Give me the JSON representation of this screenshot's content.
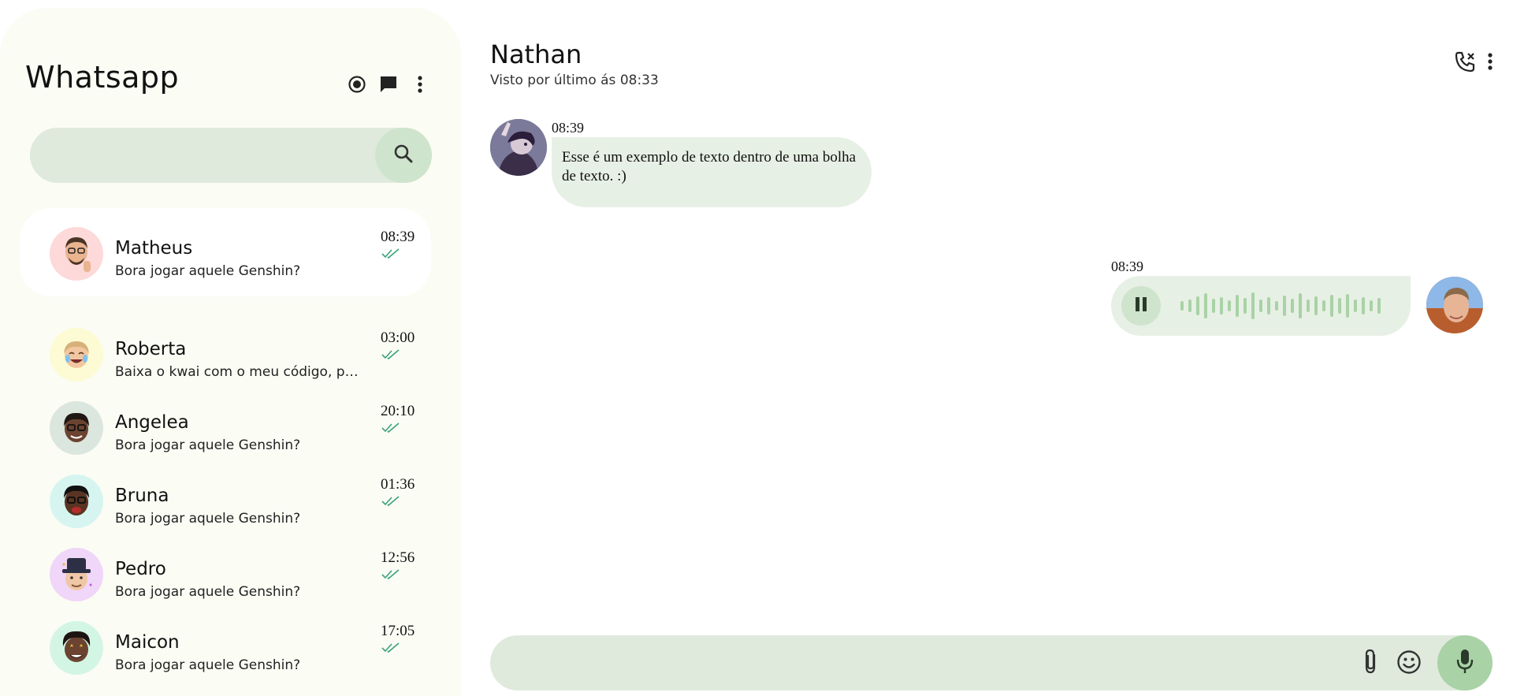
{
  "sidebar": {
    "title": "Whatsapp",
    "icons": [
      "status-icon",
      "new-chat-icon",
      "more-vert-icon"
    ],
    "search": {
      "placeholder": "",
      "icon": "search-icon"
    },
    "chats": [
      {
        "name": "Matheus",
        "preview": "Bora jogar aquele Genshin?",
        "time": "08:39",
        "read": true,
        "active": true,
        "avatar_bg": "#fdd9d9"
      },
      {
        "name": "Roberta",
        "preview": "Baixa o kwai com o meu código, por favor",
        "time": "03:00",
        "read": true,
        "active": false,
        "avatar_bg": "#fdfbd3"
      },
      {
        "name": "Angelea",
        "preview": "Bora jogar aquele Genshin?",
        "time": "20:10",
        "read": true,
        "active": false,
        "avatar_bg": "#dbe6df"
      },
      {
        "name": "Bruna",
        "preview": "Bora jogar aquele Genshin?",
        "time": "01:36",
        "read": true,
        "active": false,
        "avatar_bg": "#d6f5f1"
      },
      {
        "name": "Pedro",
        "preview": "Bora jogar aquele Genshin?",
        "time": "12:56",
        "read": true,
        "active": false,
        "avatar_bg": "#f0d6f8"
      },
      {
        "name": "Maicon",
        "preview": "Bora jogar aquele Genshin?",
        "time": "17:05",
        "read": true,
        "active": false,
        "avatar_bg": "#d3f6e4"
      }
    ]
  },
  "chat": {
    "contact_name": "Nathan",
    "last_seen": "Visto por último ás 08:33",
    "header_icons": [
      "phone-icon",
      "more-vert-icon"
    ],
    "messages": [
      {
        "type": "text",
        "direction": "incoming",
        "time": "08:39",
        "text": "Esse é um exemplo de texto dentro de uma bolha de texto. :)"
      },
      {
        "type": "audio",
        "direction": "outgoing",
        "time": "08:39",
        "state": "playing"
      }
    ],
    "composer": {
      "placeholder": "",
      "icons": [
        "attach-icon",
        "emoji-icon",
        "mic-icon"
      ]
    }
  },
  "colors": {
    "sidebar_bg": "#fbfcf4",
    "bubble_bg": "#e7f0e4",
    "input_bg": "#dfeadd",
    "accent_green": "#a9d2a6",
    "check_color": "#3aa37a"
  }
}
